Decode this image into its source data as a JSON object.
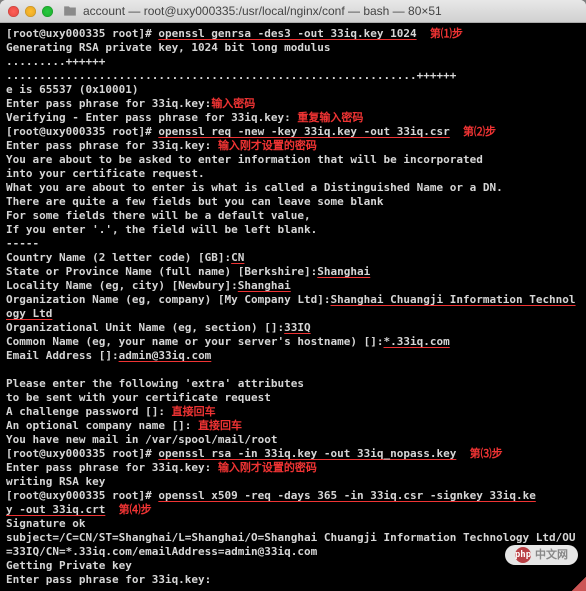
{
  "window": {
    "title": "account — root@uxy000335:/usr/local/nginx/conf — bash — 80×51"
  },
  "annotations": {
    "step1": "第⑴步",
    "step2": "第⑵步",
    "step3": "第⑶步",
    "step4": "第⑷步",
    "enter_pw": "输入密码",
    "reenter_pw": "重复输入密码",
    "enter_prev_pw": "输入刚才设置的密码",
    "enter_prev_pw2": "输入刚才设置的密码",
    "direct_enter": "直接回车",
    "direct_enter2": "直接回车"
  },
  "terminal": {
    "prompt1": "[root@uxy000335 root]#",
    "cmd1": "openssl genrsa -des3 -out 33iq.key 1024",
    "gen": "Generating RSA private key, 1024 bit long modulus",
    "dots1": ".........++++++",
    "dots2": "..............................................................++++++",
    "eis": "e is 65537 (0x10001)",
    "pass1": "Enter pass phrase for 33iq.key:",
    "verify": "Verifying - Enter pass phrase for 33iq.key:",
    "prompt2": "[root@uxy000335 root]#",
    "cmd2": "openssl req -new -key 33iq.key -out 33iq.csr",
    "pass2": "Enter pass phrase for 33iq.key:",
    "about1": "You are about to be asked to enter information that will be incorporated",
    "about2": "into your certificate request.",
    "about3": "What you are about to enter is what is called a Distinguished Name or a DN.",
    "about4": "There are quite a few fields but you can leave some blank",
    "about5": "For some fields there will be a default value,",
    "about6": "If you enter '.', the field will be left blank.",
    "dashes": "-----",
    "country_q": "Country Name (2 letter code) [GB]:",
    "country_a": "CN",
    "state_q": "State or Province Name (full name) [Berkshire]:",
    "state_a": "Shanghai",
    "locality_q": "Locality Name (eg, city) [Newbury]:",
    "locality_a": "Shanghai",
    "org_q": "Organization Name (eg, company) [My Company Ltd]:",
    "org_a": "Shanghai Chuangji Information Technology Ltd",
    "ou_q": "Organizational Unit Name (eg, section) []:",
    "ou_a": "33IQ",
    "cn_q": "Common Name (eg, your name or your server's hostname) []:",
    "cn_a": "*.33iq.com",
    "email_q": "Email Address []:",
    "email_a": "admin@33iq.com",
    "extra1": "Please enter the following 'extra' attributes",
    "extra2": "to be sent with your certificate request",
    "challenge": "A challenge password []:",
    "optcomp": "An optional company name []:",
    "mail": "You have new mail in /var/spool/mail/root",
    "prompt3": "[root@uxy000335 root]#",
    "cmd3": "openssl rsa -in 33iq.key -out 33iq_nopass.key",
    "pass3": "Enter pass phrase for 33iq.key:",
    "writing": "writing RSA key",
    "prompt4": "[root@uxy000335 root]#",
    "cmd4a": "openssl x509 -req -days 365 -in 33iq.csr -signkey 33iq.ke",
    "cmd4b": "y -out 33iq.crt",
    "sigok": "Signature ok",
    "subject": "subject=/C=CN/ST=Shanghai/L=Shanghai/O=Shanghai Chuangji Information Technology Ltd/OU=33IQ/CN=*.33iq.com/emailAddress=admin@33iq.com",
    "getpriv": "Getting Private key",
    "pass4": "Enter pass phrase for 33iq.key:"
  },
  "watermark": "中文网",
  "watermark_logo": "php"
}
